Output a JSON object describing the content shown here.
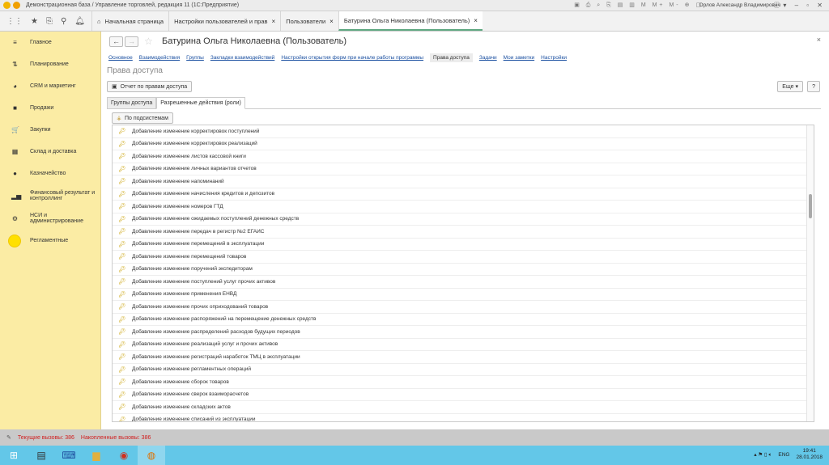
{
  "window": {
    "title": "Демонстрационная база / Управление торговлей, редакция 11  (1С:Предприятие)",
    "user": "Орлов Александр Владимирович"
  },
  "tabs": [
    {
      "label": "Начальная страница"
    },
    {
      "label": "Настройки пользователей и прав"
    },
    {
      "label": "Пользователи"
    },
    {
      "label": "Батурина Ольга Николаевна (Пользователь)"
    }
  ],
  "sidebar": {
    "items": [
      {
        "label": "Главное",
        "icon": "≡"
      },
      {
        "label": "Планирование",
        "icon": "⇅"
      },
      {
        "label": "CRM и маркетинг",
        "icon": "◕"
      },
      {
        "label": "Продажи",
        "icon": "■"
      },
      {
        "label": "Закупки",
        "icon": "🛒"
      },
      {
        "label": "Склад и доставка",
        "icon": "▦"
      },
      {
        "label": "Казначейство",
        "icon": "●"
      },
      {
        "label": "Финансовый результат и контроллинг",
        "icon": "▂▅"
      },
      {
        "label": "НСИ и администрирование",
        "icon": "⚙"
      },
      {
        "label": "Регламентные",
        "icon": ""
      }
    ]
  },
  "page": {
    "title": "Батурина Ольга Николаевна (Пользователь)",
    "section": "Права доступа",
    "more": "Еще",
    "help": "?",
    "links": [
      "Основное",
      "Взаимодействия",
      "Группы",
      "Закладки взаимодействий",
      "Настройки открытия форм при начале работы программы",
      "Права доступа",
      "Задачи",
      "Мои заметки",
      "Настройки"
    ],
    "report_button": "Отчет по правам доступа",
    "form_tabs": [
      "Группы доступа",
      "Разрешенные действия (роли)"
    ],
    "subsystems_button": "По подсистемам",
    "rows": [
      "Добавление изменение корректировок поступлений",
      "Добавление изменение корректировок реализаций",
      "Добавление изменение листов кассовой книги",
      "Добавление изменение личных вариантов отчетов",
      "Добавление изменение напоминаний",
      "Добавление изменение начисления кредитов и депозитов",
      "Добавление изменение номеров ГТД",
      "Добавление изменение ожидаемых поступлений денежных средств",
      "Добавление изменение передач в регистр №2 ЕГАИС",
      "Добавление изменение перемещений в эксплуатации",
      "Добавление изменение перемещений товаров",
      "Добавление изменение поручений экспедиторам",
      "Добавление изменение поступлений услуг прочих активов",
      "Добавление изменение применения ЕНВД",
      "Добавление изменение прочих оприходований товаров",
      "Добавление изменение распоряжений на перемещение денежных средств",
      "Добавление изменение распределений расходов будущих периодов",
      "Добавление изменение реализаций услуг и прочих активов",
      "Добавление изменение регистраций наработок ТМЦ в эксплуатации",
      "Добавление изменение регламентных операций",
      "Добавление изменение сборок товаров",
      "Добавление изменение сверок взаиморасчетов",
      "Добавление изменение складских актов",
      "Добавление изменение списаний из эксплуатации"
    ],
    "scroll_position": 0.22
  },
  "status": {
    "current": "Текущие вызовы: 386",
    "accumulated": "Накопленные вызовы: 386"
  },
  "tray": {
    "lang": "ENG",
    "time": "19:41",
    "date": "28.01.2018"
  }
}
